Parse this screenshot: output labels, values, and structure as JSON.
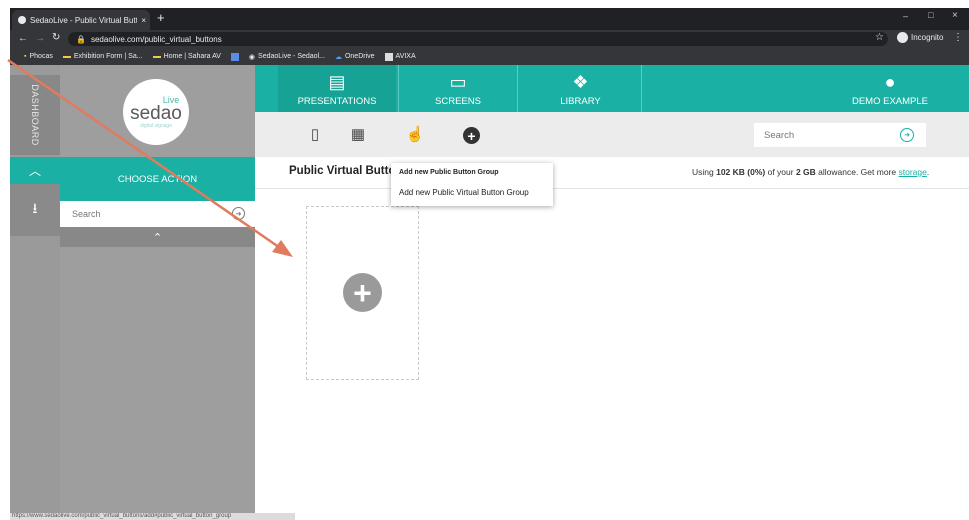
{
  "browser": {
    "tab_title": "SedaoLive - Public Virtual Button",
    "tab_close": "×",
    "new_tab": "+",
    "url": "sedaolive.com/public_virtual_buttons",
    "profile_label": "Incognito",
    "window_controls": [
      "–",
      "□",
      "×"
    ],
    "bookmarks": [
      "Phocas",
      "Exhibition Form | Sa...",
      "Home | Sahara AV",
      "SedaoLive - Sedaol...",
      "OneDrive",
      "AVIXA"
    ],
    "status_url": "https://www.sedaolive.com/public_virtual_buttons/add#public_virtual_button_group"
  },
  "logo": {
    "top": "Live",
    "brand": "sedao",
    "tagline": "digital signage"
  },
  "dashboard": {
    "label": "DASHBOARD"
  },
  "sidebar": {
    "choose_action": "CHOOSE ACTION",
    "search_placeholder": "Search"
  },
  "nav": {
    "presentations": "PRESENTATIONS",
    "screens": "SCREENS",
    "library": "LIBRARY",
    "user": "DEMO EXAMPLE"
  },
  "toolbar": {
    "search_placeholder": "Search"
  },
  "main": {
    "title": "Public Virtual Buttons",
    "usage_prefix": "Using ",
    "usage_used": "102 KB (0%)",
    "usage_mid": " of your ",
    "usage_total": "2 GB",
    "usage_suffix": " allowance. Get more ",
    "usage_link": "storage",
    "usage_end": "."
  },
  "dropdown": {
    "items": [
      "Add new Public Button Group",
      "Add new Public Virtual Button Group"
    ]
  },
  "colors": {
    "accent": "#1ab1a4",
    "arrow": "#e07b5e",
    "sidebar": "#9e9e9e"
  }
}
